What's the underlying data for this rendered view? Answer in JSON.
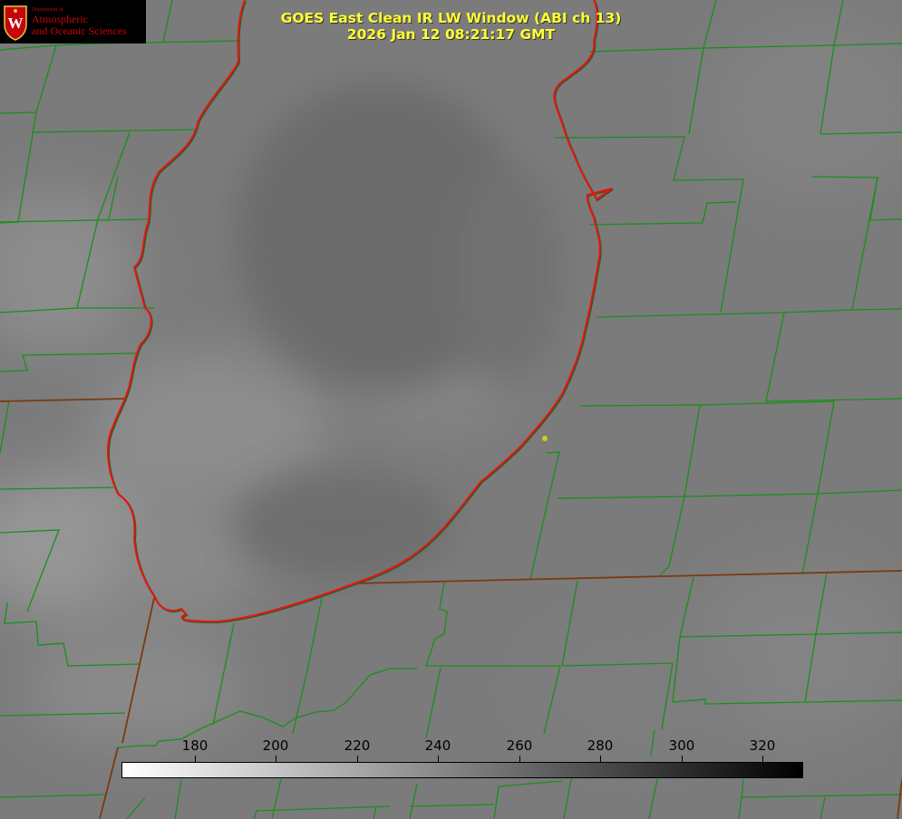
{
  "title": {
    "line1": "GOES East Clean IR LW Window (ABI ch 13)",
    "line2": "2026 Jan 12 08:21:17 GMT"
  },
  "logo": {
    "department": "Department of",
    "name_line1": "Atmospheric",
    "name_line2": "and Oceanic Sciences",
    "crest_icon": "uw-crest-icon"
  },
  "colorbar": {
    "ticks": [
      "180",
      "200",
      "220",
      "240",
      "260",
      "280",
      "300",
      "320"
    ],
    "gradient_start": "#ffffff",
    "gradient_end": "#000000"
  },
  "colors": {
    "county_lines": "#1a8f1a",
    "coastline": "#e8160e",
    "state_lines": "#7a3a12",
    "text": "#ffff33",
    "marker": "#cccc22"
  }
}
